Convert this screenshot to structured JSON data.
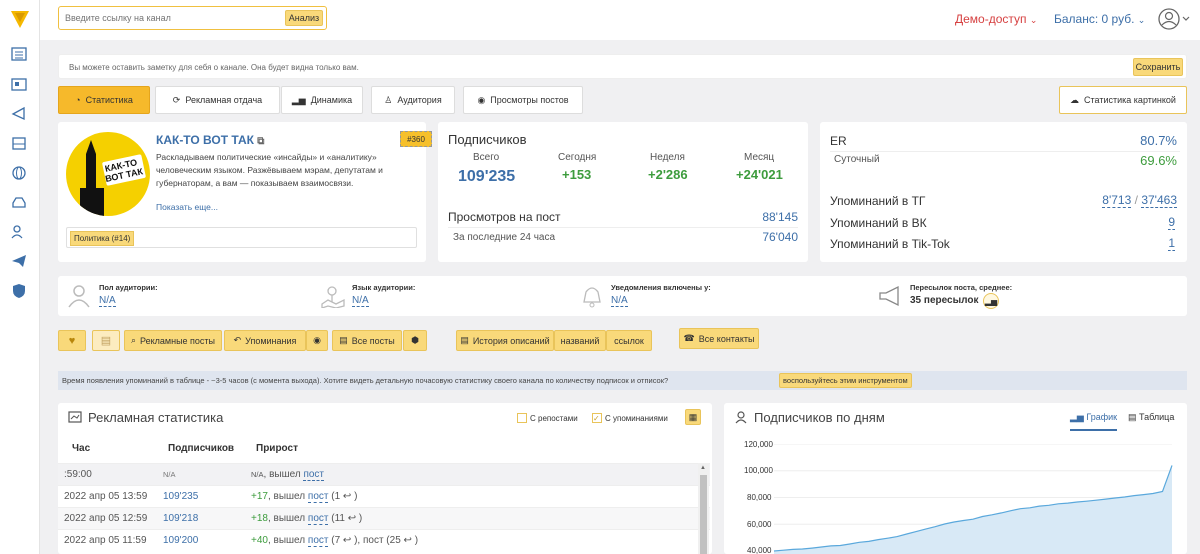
{
  "header": {
    "search_placeholder": "Введите ссылку на канал",
    "analyze": "Анализ",
    "demo": "Демо-доступ",
    "balance": "Баланс: 0 руб."
  },
  "note": {
    "text": "Вы можете оставить заметку для себя о канале. Она будет видна только вам.",
    "save": "Сохранить"
  },
  "tabs": [
    "Статистика",
    "Рекламная отдача",
    "Динамика",
    "Аудитория",
    "Просмотры постов"
  ],
  "stats_image": "Статистика картинкой",
  "channel": {
    "name": "КАК-ТО ВОТ ТАК",
    "badge": "#360",
    "avatar_text": "КАК-ТО ВОТ ТАК",
    "description": "Раскладываем политические «инсайды» и «аналитику» человеческим языком. Разжёвываем мэрам, депутатам и губернаторам, а вам — показываем взаимосвязи.",
    "more": "Показать еще...",
    "category": "Политика (#14)"
  },
  "subs": {
    "title": "Подписчиков",
    "total_l": "Всего",
    "total": "109'235",
    "today_l": "Сегодня",
    "today": "+153",
    "week_l": "Неделя",
    "week": "+2'286",
    "month_l": "Месяц",
    "month": "+24'021",
    "views_l": "Просмотров на пост",
    "views": "88'145",
    "last24_l": "За последние 24 часа",
    "last24": "76'040"
  },
  "er": {
    "er_l": "ER",
    "er": "80.7%",
    "daily_l": "Суточный",
    "daily": "69.6%",
    "tg_l": "Упоминаний в ТГ",
    "tg_a": "8'713",
    "tg_sep": "/",
    "tg_b": "37'463",
    "vk_l": "Упоминаний в ВК",
    "vk": "9",
    "tt_l": "Упоминаний в Tik-Tok",
    "tt": "1"
  },
  "audience": {
    "gender_l": "Пол аудитории:",
    "gender": "N/A",
    "lang_l": "Язык аудитории:",
    "lang": "N/A",
    "notif_l": "Уведомления включены у:",
    "notif": "N/A",
    "fwd_l": "Пересылок поста, среднее:",
    "fwd": "35 пересылок"
  },
  "toolbar": {
    "ads": "Рекламные посты",
    "mentions": "Упоминания",
    "posts": "Все посты",
    "history": "История описаний",
    "names": "названий",
    "links": "ссылок",
    "contacts": "Все контакты"
  },
  "info": {
    "text": "Время появления упоминаний в таблице - ~3-5 часов (с момента выхода). Хотите видеть детальную почасовую статистику своего канала по количеству подписок и отписок?",
    "link": "воспользуйтесь этим инструментом"
  },
  "adstat": {
    "title": "Рекламная статистика",
    "reposts": "С репостами",
    "mentions": "С упоминаниями",
    "col1": "Час",
    "col2": "Подписчиков",
    "col3": "Прирост",
    "rows": [
      {
        "t": ":59:00",
        "s": "N/A",
        "g": "N/A",
        "w": ", вышел",
        "p": "пост",
        "c": ""
      },
      {
        "t": "2022 апр 05 13:59",
        "s": "109'235",
        "g": "+17",
        "w": ", вышел",
        "p": "пост",
        "c": "(1 ↩ )"
      },
      {
        "t": "2022 апр 05 12:59",
        "s": "109'218",
        "g": "+18",
        "w": ", вышел",
        "p": "пост",
        "c": "(11 ↩ )"
      },
      {
        "t": "2022 апр 05 11:59",
        "s": "109'200",
        "g": "+40",
        "w": ", вышел",
        "p": "пост",
        "c": "(7 ↩ ), пост (25 ↩ )"
      }
    ]
  },
  "subsday": {
    "title": "Подписчиков по дням",
    "graph": "График",
    "table": "Таблица"
  },
  "chart_data": {
    "type": "area",
    "title": "Подписчиков по дням",
    "yticks": [
      "120,000",
      "100,000",
      "80,000",
      "60,000",
      "40,000"
    ],
    "ylim": [
      40000,
      120000
    ],
    "values": [
      40000,
      40600,
      41200,
      41500,
      42200,
      43000,
      43800,
      44100,
      45200,
      46500,
      47200,
      48500,
      49600,
      50800,
      52700,
      54500,
      56400,
      58200,
      60200,
      61700,
      62800,
      63800,
      65800,
      67100,
      68500,
      70100,
      71600,
      72300,
      73600,
      74200,
      75300,
      75800,
      76600,
      77200,
      78000,
      78800,
      79600,
      80400,
      81400,
      82200,
      83000,
      84500,
      104000
    ]
  },
  "colors": {
    "accent": "#f9d97a",
    "link": "#3d6fa8",
    "green": "#3d9c3d",
    "red": "#d64040"
  }
}
